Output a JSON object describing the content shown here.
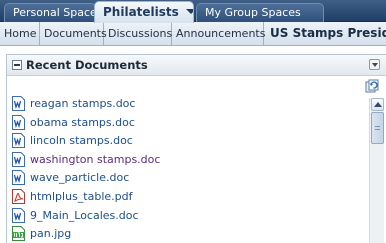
{
  "tabs": [
    {
      "label": "Personal Space",
      "active": false
    },
    {
      "label": "Philatelists",
      "active": true
    },
    {
      "label": "My Group Spaces",
      "active": false
    }
  ],
  "subnav": {
    "items": [
      "Home",
      "Documents",
      "Discussions",
      "Announcements"
    ],
    "current": "US Stamps Presiden..."
  },
  "portlet": {
    "title": "Recent Documents",
    "documents": [
      {
        "name": "reagan stamps.doc",
        "icon": "word-doc-icon"
      },
      {
        "name": "obama stamps.doc",
        "icon": "word-doc-icon"
      },
      {
        "name": "lincoln stamps.doc",
        "icon": "word-doc-icon"
      },
      {
        "name": "washington stamps.doc",
        "icon": "word-doc-icon",
        "visited": true
      },
      {
        "name": "wave_particle.doc",
        "icon": "word-doc-icon"
      },
      {
        "name": "htmlplus_table.pdf",
        "icon": "pdf-icon"
      },
      {
        "name": "9_Main_Locales.doc",
        "icon": "word-doc-icon"
      },
      {
        "name": "pan.jpg",
        "icon": "jpg-image-icon"
      }
    ]
  },
  "colors": {
    "tabbar": "#2c4b73",
    "link": "#1d4f8c",
    "visited_link": "#5a2d82"
  }
}
